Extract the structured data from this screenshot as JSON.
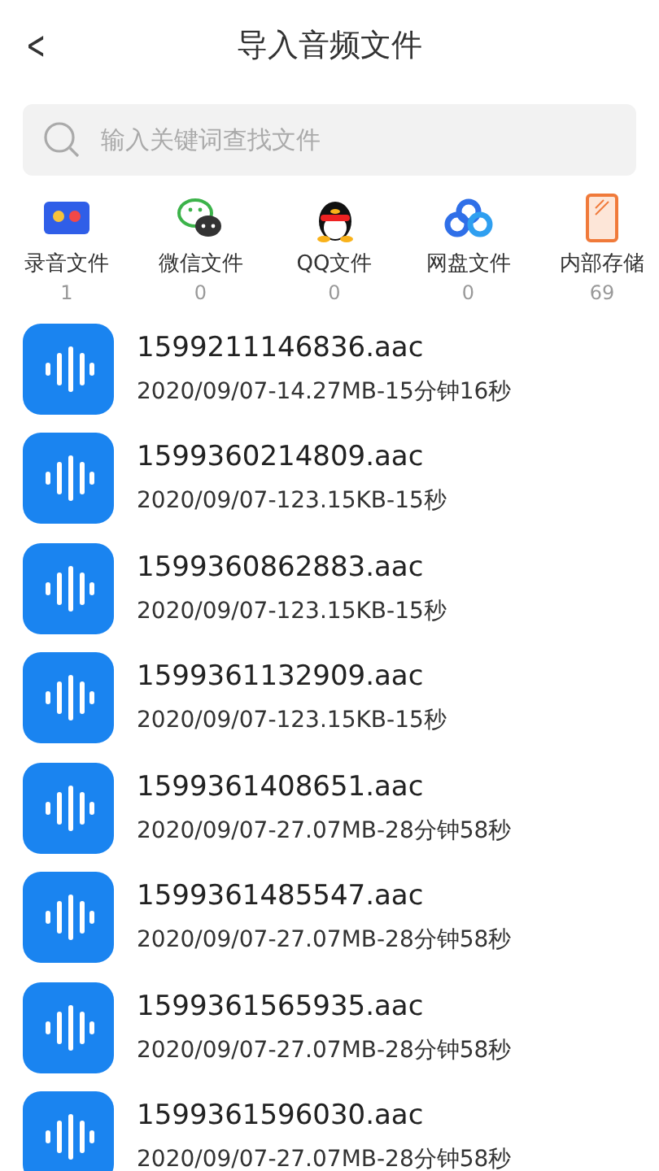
{
  "header": {
    "back": "<",
    "title": "导入音频文件"
  },
  "search": {
    "placeholder": "输入关键词查找文件"
  },
  "sources": [
    {
      "kind": "recorder",
      "label": "录音文件",
      "count": "1"
    },
    {
      "kind": "wechat",
      "label": "微信文件",
      "count": "0"
    },
    {
      "kind": "qq",
      "label": "QQ文件",
      "count": "0"
    },
    {
      "kind": "cloud",
      "label": "网盘文件",
      "count": "0"
    },
    {
      "kind": "phone",
      "label": "内部存储",
      "count": "69"
    }
  ],
  "files": [
    {
      "name": "1599211146836.aac",
      "info": "2020/09/07-14.27MB-15分钟16秒"
    },
    {
      "name": "1599360214809.aac",
      "info": "2020/09/07-123.15KB-15秒"
    },
    {
      "name": "1599360862883.aac",
      "info": "2020/09/07-123.15KB-15秒"
    },
    {
      "name": "1599361132909.aac",
      "info": "2020/09/07-123.15KB-15秒"
    },
    {
      "name": "1599361408651.aac",
      "info": "2020/09/07-27.07MB-28分钟58秒"
    },
    {
      "name": "1599361485547.aac",
      "info": "2020/09/07-27.07MB-28分钟58秒"
    },
    {
      "name": "1599361565935.aac",
      "info": "2020/09/07-27.07MB-28分钟58秒"
    },
    {
      "name": "1599361596030.aac",
      "info": "2020/09/07-27.07MB-28分钟58秒"
    }
  ]
}
